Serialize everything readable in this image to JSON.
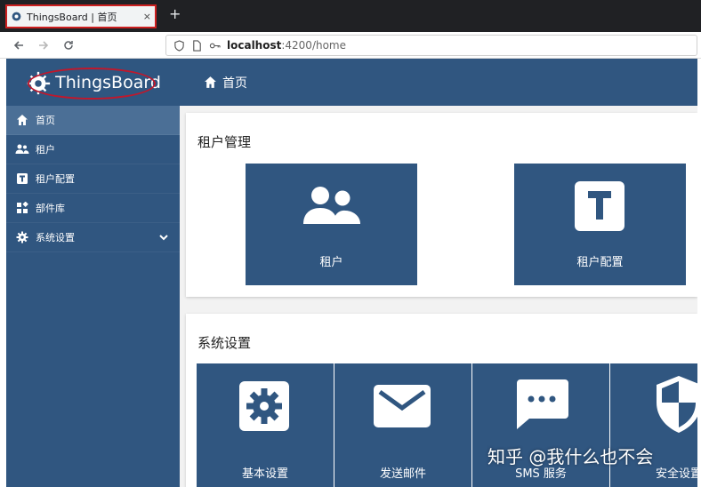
{
  "browser": {
    "tab_title": "ThingsBoard | 首页",
    "tab_close": "×",
    "new_tab": "+",
    "url_host": "localhost",
    "url_rest": ":4200/home"
  },
  "sidebar": {
    "brand": "ThingsBoard",
    "items": [
      {
        "label": "首页",
        "icon": "home-icon",
        "active": true
      },
      {
        "label": "租户",
        "icon": "users-icon"
      },
      {
        "label": "租户配置",
        "icon": "t-box-icon"
      },
      {
        "label": "部件库",
        "icon": "widgets-icon"
      },
      {
        "label": "系统设置",
        "icon": "gear-icon",
        "expandable": true
      }
    ]
  },
  "topbar": {
    "breadcrumb": "首页"
  },
  "sections": {
    "tenant_mgmt": {
      "title": "租户管理",
      "tiles": [
        {
          "label": "租户",
          "icon": "users-icon"
        },
        {
          "label": "租户配置",
          "icon": "t-box-icon"
        }
      ]
    },
    "system_settings": {
      "title": "系统设置",
      "tiles": [
        {
          "label": "基本设置",
          "icon": "gear-icon"
        },
        {
          "label": "发送邮件",
          "icon": "mail-icon"
        },
        {
          "label": "SMS 服务",
          "icon": "sms-icon"
        },
        {
          "label": "安全设置",
          "icon": "shield-icon"
        }
      ]
    }
  },
  "watermark": "知乎 @我什么也不会",
  "colors": {
    "primary": "#305680",
    "active": "#4b6f96",
    "highlight_ring": "#c0182c"
  }
}
